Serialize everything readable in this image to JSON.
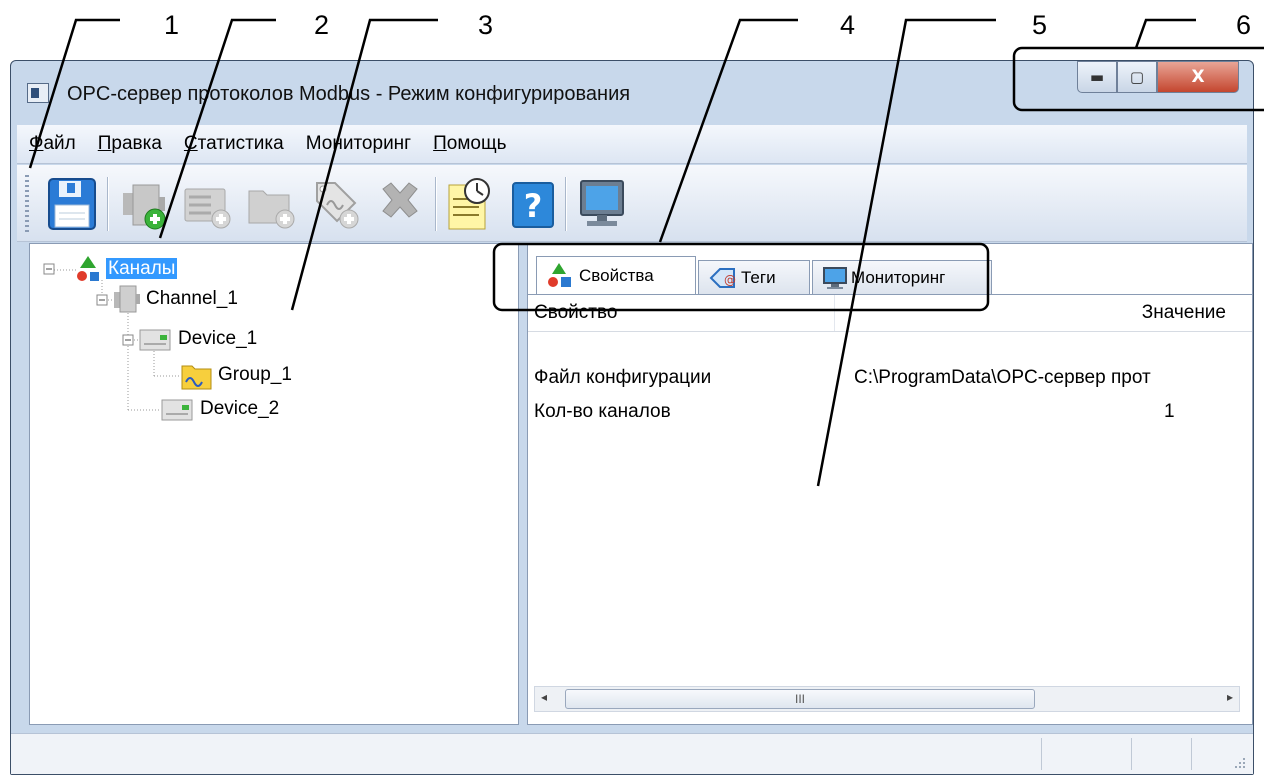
{
  "callouts": [
    "1",
    "2",
    "3",
    "4",
    "5",
    "6"
  ],
  "window": {
    "title": "OPC-сервер протоколов Modbus - Режим конфигурирования",
    "buttons": {
      "minimize": "▬",
      "maximize": "▢",
      "close": "X"
    }
  },
  "menu": [
    {
      "label": "Файл",
      "accel": "Ф",
      "rest": "айл"
    },
    {
      "label": "Правка",
      "accel": "П",
      "rest": "равка"
    },
    {
      "label": "Статистика",
      "accel": "С",
      "rest": "татистика"
    },
    {
      "label": "Мониторинг",
      "accel": "",
      "rest": "Мониторинг"
    },
    {
      "label": "Помощь",
      "accel": "П",
      "rest": "омощь"
    }
  ],
  "toolbar": {
    "icons": [
      "save-icon",
      "add-channel-icon",
      "add-device-icon",
      "add-group-icon",
      "add-tag-icon",
      "delete-icon",
      "event-log-icon",
      "help-icon",
      "monitor-icon"
    ]
  },
  "tree": {
    "root": "Каналы",
    "channel": "Channel_1",
    "device1": "Device_1",
    "group1": "Group_1",
    "device2": "Device_2"
  },
  "tabs": [
    {
      "label": "Свойства",
      "active": true
    },
    {
      "label": "Теги",
      "active": false
    },
    {
      "label": "Мониторинг",
      "active": false
    }
  ],
  "properties": {
    "columns": [
      "Свойство",
      "Значение"
    ],
    "rows": [
      {
        "name": "Файл конфигурации",
        "value": "C:\\ProgramData\\OPC-сервер прот"
      },
      {
        "name": "Кол-во каналов",
        "value": "1"
      }
    ]
  },
  "scrollbar": {
    "grip": "III",
    "left": "◂",
    "right": "▸"
  },
  "colors": {
    "selection": "#3399ff",
    "window_frame": "#c8d8eb",
    "close_button": "#c4462f"
  }
}
